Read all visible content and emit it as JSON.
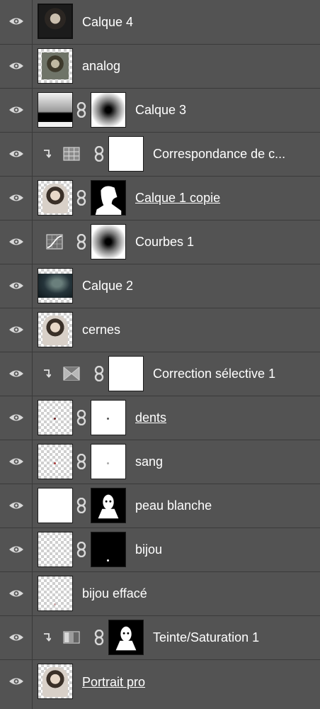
{
  "layers_panel": {
    "layers": [
      {
        "name": "Calque 4",
        "underlined": false
      },
      {
        "name": "analog",
        "underlined": false
      },
      {
        "name": "Calque 3",
        "underlined": false
      },
      {
        "name": "Correspondance de c...",
        "underlined": false,
        "clipped": true,
        "adjustment_icon": "color-lookup-grid-icon"
      },
      {
        "name": "Calque 1 copie",
        "underlined": true
      },
      {
        "name": "Courbes 1",
        "underlined": false,
        "adjustment_icon": "curves-icon"
      },
      {
        "name": "Calque 2",
        "underlined": false
      },
      {
        "name": "cernes",
        "underlined": false
      },
      {
        "name": "Correction sélective 1",
        "underlined": false,
        "clipped": true,
        "adjustment_icon": "selective-color-icon"
      },
      {
        "name": "dents",
        "underlined": true
      },
      {
        "name": "sang",
        "underlined": false
      },
      {
        "name": "peau blanche",
        "underlined": false
      },
      {
        "name": "bijou",
        "underlined": false
      },
      {
        "name": "bijou effacé",
        "underlined": false
      },
      {
        "name": "Teinte/Saturation 1",
        "underlined": false,
        "clipped": true,
        "adjustment_icon": "hue-saturation-icon"
      },
      {
        "name": "Portrait pro",
        "underlined": true
      }
    ]
  },
  "colors": {
    "panel_bg": "#535353",
    "separator": "#3a3a3a",
    "text": "#ffffff"
  }
}
